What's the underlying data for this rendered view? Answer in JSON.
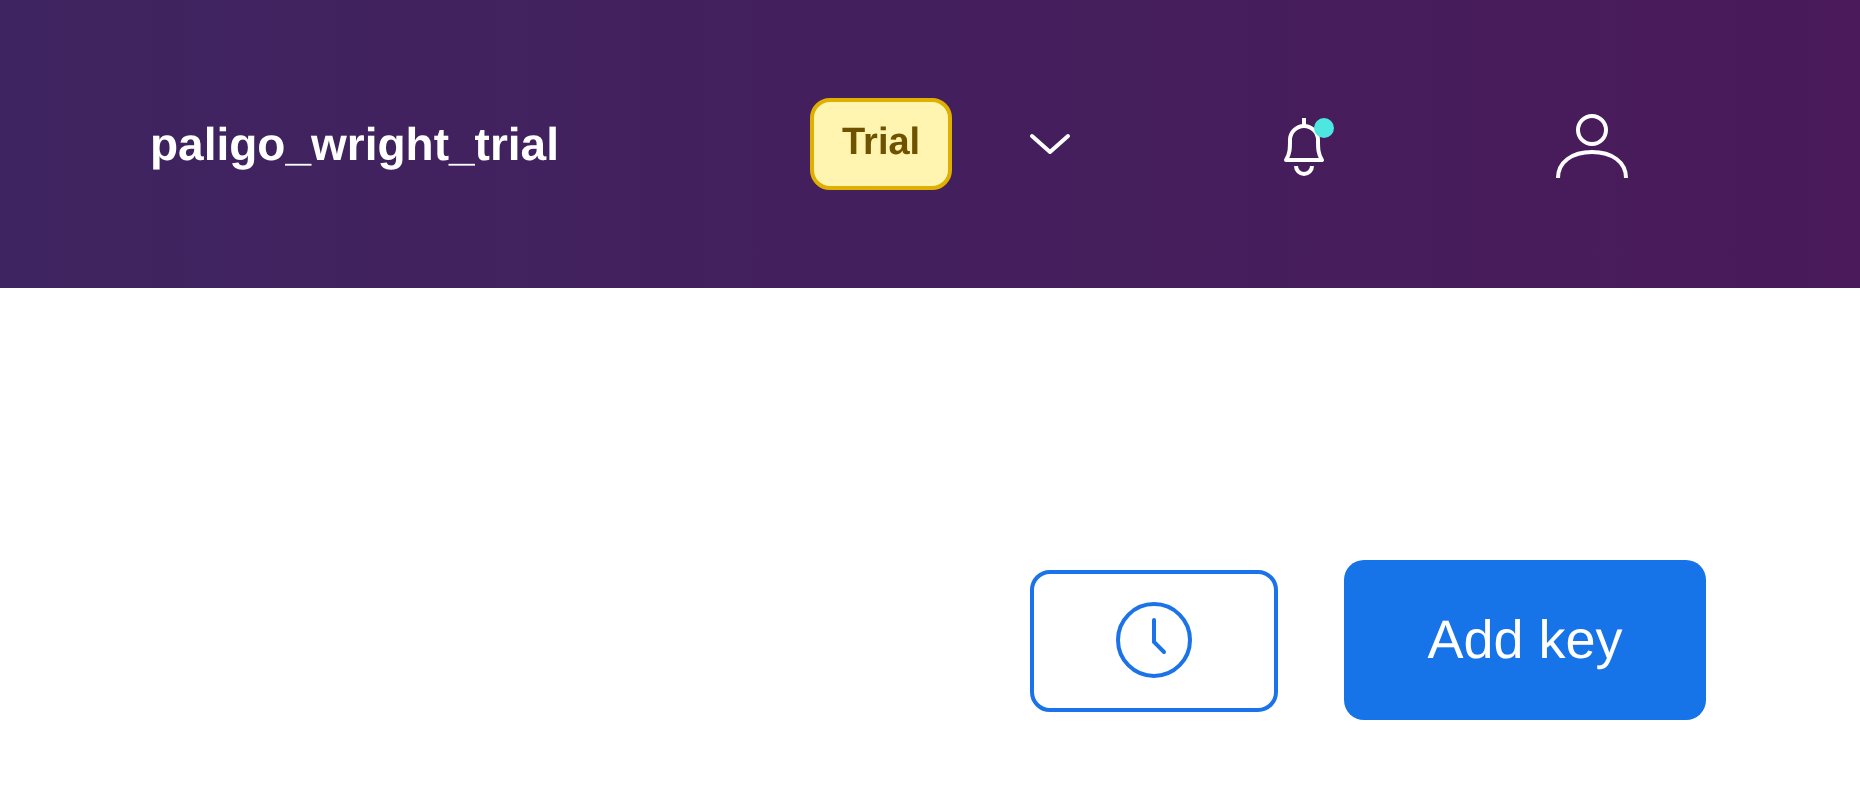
{
  "header": {
    "account_name": "paligo_wright_trial",
    "plan_badge": "Trial",
    "notifications": {
      "unread": true
    }
  },
  "actions": {
    "add_button": "Add key"
  }
}
